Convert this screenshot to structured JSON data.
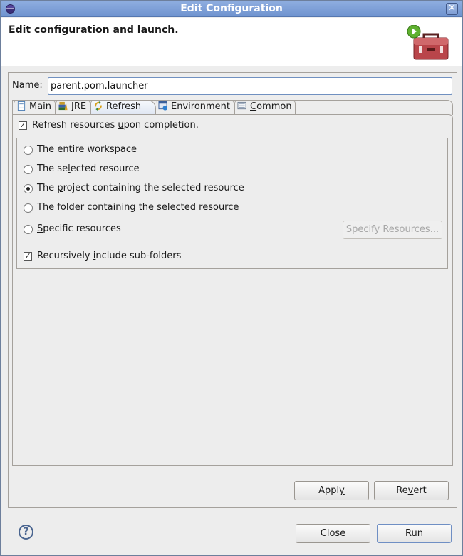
{
  "window": {
    "title": "Edit Configuration",
    "app_icon": "eclipse-icon",
    "close_icon": "close-icon"
  },
  "header": {
    "title": "Edit configuration and launch.",
    "banner_icon": "toolbox-run-icon"
  },
  "name_field": {
    "label_mnemonic": "N",
    "label_rest": "ame:",
    "value": "parent.pom.launcher"
  },
  "tabs": [
    {
      "label": "Main",
      "icon": "main-tab-icon",
      "active": false
    },
    {
      "label": "JRE",
      "icon": "jre-library-icon",
      "active": false
    },
    {
      "label": "Refresh",
      "icon": "refresh-icon",
      "active": true
    },
    {
      "label": "Environment",
      "icon": "environment-icon",
      "active": false
    },
    {
      "label_mnemonic": "C",
      "label_rest": "ommon",
      "label": "Common",
      "icon": "common-tab-icon",
      "active": false
    }
  ],
  "refresh": {
    "refresh_on_completion": {
      "pre": "Refresh resources ",
      "mnemonic": "u",
      "post": "pon completion.",
      "checked": true
    },
    "scope_options": [
      {
        "pre": "The ",
        "mnemonic": "e",
        "post": "ntire workspace",
        "selected": false
      },
      {
        "pre": "The se",
        "mnemonic": "l",
        "post": "ected resource",
        "selected": false
      },
      {
        "pre": "The ",
        "mnemonic": "p",
        "post": "roject containing the selected resource",
        "selected": true
      },
      {
        "pre": "The f",
        "mnemonic": "o",
        "post": "lder containing the selected resource",
        "selected": false
      },
      {
        "pre": "",
        "mnemonic": "S",
        "post": "pecific resources",
        "selected": false
      }
    ],
    "specify_resources_button": {
      "pre": "Specify ",
      "mnemonic": "R",
      "post": "esources...",
      "enabled": false
    },
    "recursive": {
      "pre": "Recursively ",
      "mnemonic": "i",
      "post": "nclude sub-folders",
      "checked": true
    }
  },
  "buttons": {
    "apply": {
      "pre": "Appl",
      "mnemonic": "y",
      "post": ""
    },
    "revert": {
      "pre": "Re",
      "mnemonic": "v",
      "post": "ert"
    },
    "close": {
      "label": "Close"
    },
    "run": {
      "pre": "",
      "mnemonic": "R",
      "post": "un"
    }
  },
  "help_icon": "help-icon"
}
